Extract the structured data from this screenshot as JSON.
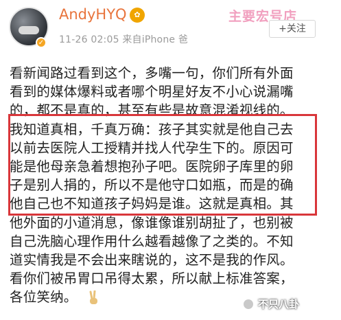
{
  "header": {
    "username": "AndyHYQ",
    "username_badge": "✿",
    "timestamp": "11-26 02:05",
    "source": "来自iPhone 爸",
    "follow_label": "+关注",
    "top_watermark": "主要宏号店"
  },
  "post": {
    "lines": [
      "看新闻路过看到这个，多嘴一句，你们所有外面",
      "看到的媒体爆料或者哪个明星好友不小心说漏嘴",
      "的，都不是真的，甚至有些是故意混淆视线的。",
      "我知道真相，千真万确：孩子其实就是他自己去",
      "以前去医院人工授精并找人代孕生下的。原因可",
      "能是他母亲急着想抱孙子吧。医院卵子库里的卵",
      "子是别人捐的，所以不是他守口如瓶，而是的确",
      "他自己也不知道孩子妈妈是谁。这就是真相。其",
      "他外面的小道消息，像谁像谁别胡扯了，也别被",
      "自己洗脑心理作用什么越看越像了之类的。不知",
      "道实情我是不会出来瞎说的，这不是我的作风。",
      "看你们被吊胃口吊得太累，所以献上标准答案，",
      "各位笑纳。"
    ],
    "emoji_icon": "peace-hand-icon"
  },
  "watermark": {
    "text": "不只八卦"
  },
  "colors": {
    "username": "#e8743c",
    "highlight_border": "#d9363a",
    "meta_text": "#9a9a9a"
  }
}
